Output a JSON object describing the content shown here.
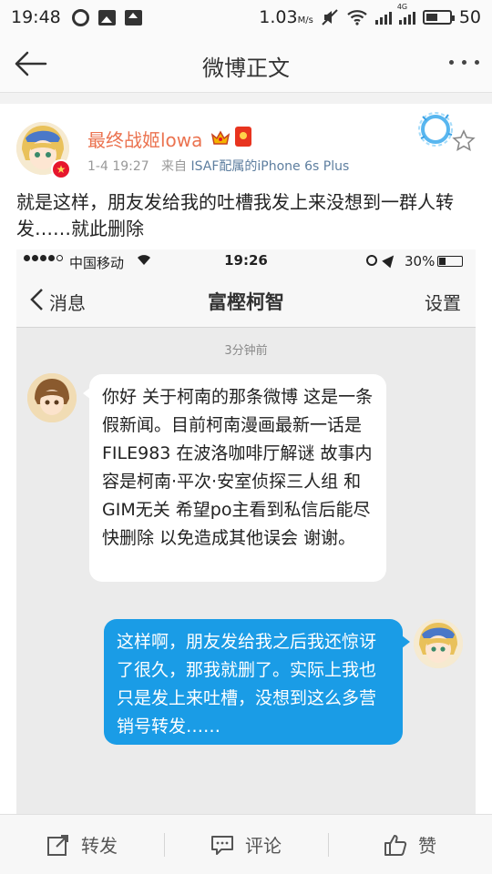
{
  "status_bar": {
    "time": "19:48",
    "speed": "1.03",
    "speed_unit": "M/s",
    "network": "4G",
    "battery": "50",
    "icons": [
      "sync-icon",
      "image-icon",
      "upload-icon",
      "mute-icon",
      "wifi-icon",
      "signal-icon",
      "battery-icon"
    ]
  },
  "header": {
    "title": "微博正文"
  },
  "post": {
    "username": "最终战姬lowa",
    "timestamp": "1-4 19:27",
    "source_prefix": "来自",
    "source": "ISAF配属的iPhone 6s Plus",
    "text": "就是这样，朋友发给我的吐槽我发上来没想到一群人转发……就此删除"
  },
  "screenshot": {
    "status": {
      "carrier": "中国移动",
      "time": "19:26",
      "battery": "30%"
    },
    "nav": {
      "back_label": "消息",
      "contact": "富樫柯智",
      "settings_label": "设置"
    },
    "timestamp": "3分钟前",
    "incoming_message": "你好 关于柯南的那条微博 这是一条假新闻。目前柯南漫画最新一话是 FILE983 在波洛咖啡厅解谜 故事内容是柯南·平次·安室侦探三人组 和GIM无关 希望po主看到私信后能尽快删除 以免造成其他误会 谢谢。",
    "outgoing_message": "这样啊，朋友发给我之后我还惊讶了很久，那我就删了。实际上我也只是发上来吐槽，没想到这么多营销号转发……"
  },
  "actions": {
    "repost": "转发",
    "comment": "评论",
    "like": "赞"
  },
  "colors": {
    "username": "#eb7350",
    "source_link": "#5d7e9f",
    "outgoing_bubble": "#1a9ce6",
    "badge_red": "#e6162d"
  }
}
